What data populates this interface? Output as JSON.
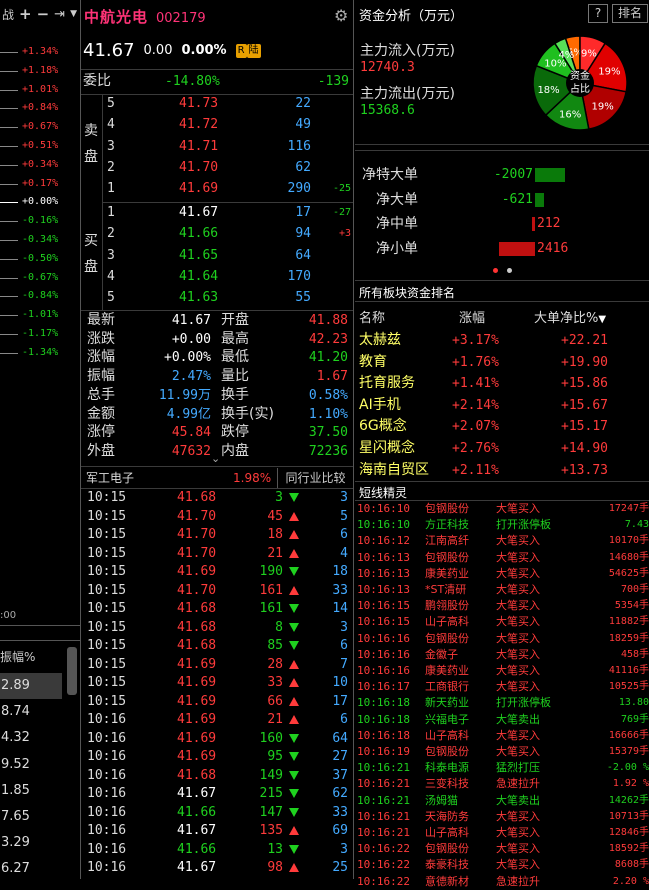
{
  "toolbar": {
    "left_label": "战",
    "icons": [
      "plus-icon",
      "minus-icon",
      "pin-icon",
      "menu-chevron-icon"
    ]
  },
  "chart_axis": {
    "percents": [
      "+1.34%",
      "+1.18%",
      "+1.01%",
      "+0.84%",
      "+0.67%",
      "+0.51%",
      "+0.34%",
      "+0.17%",
      "+0.00%",
      "-0.16%",
      "-0.34%",
      "-0.50%",
      "-0.67%",
      "-0.84%",
      "-1.01%",
      "-1.17%",
      "-1.34%"
    ],
    "time_label": ":00"
  },
  "left_list": {
    "header": "振幅%",
    "values": [
      "2.89",
      "8.74",
      "4.32",
      "9.52",
      "1.85",
      "7.65",
      "3.29",
      "6.27"
    ]
  },
  "stock": {
    "name": "中航光电",
    "code": "002179",
    "price": "41.67",
    "change": "0.00",
    "change_pct": "0.00%",
    "badge_r": "R",
    "badge_lu": "陆"
  },
  "order_ratio": {
    "label": "委比",
    "pct": "-14.80%",
    "diff": "-139"
  },
  "sell": {
    "label": "卖盘",
    "rows": [
      {
        "lvl": "5",
        "price": "41.73",
        "vol": "22",
        "chg": ""
      },
      {
        "lvl": "4",
        "price": "41.72",
        "vol": "49",
        "chg": ""
      },
      {
        "lvl": "3",
        "price": "41.71",
        "vol": "116",
        "chg": ""
      },
      {
        "lvl": "2",
        "price": "41.70",
        "vol": "62",
        "chg": ""
      },
      {
        "lvl": "1",
        "price": "41.69",
        "vol": "290",
        "chg": "-25"
      }
    ]
  },
  "buy": {
    "label": "买盘",
    "rows": [
      {
        "lvl": "1",
        "price": "41.67",
        "vol": "17",
        "chg": "-27"
      },
      {
        "lvl": "2",
        "price": "41.66",
        "vol": "94",
        "chg": "+3"
      },
      {
        "lvl": "3",
        "price": "41.65",
        "vol": "64",
        "chg": ""
      },
      {
        "lvl": "4",
        "price": "41.64",
        "vol": "170",
        "chg": ""
      },
      {
        "lvl": "5",
        "price": "41.63",
        "vol": "55",
        "chg": ""
      }
    ]
  },
  "stats": [
    {
      "l1": "最新",
      "v1": "41.67",
      "c1": "wht",
      "l2": "开盘",
      "v2": "41.88",
      "c2": "red"
    },
    {
      "l1": "涨跌",
      "v1": "+0.00",
      "c1": "wht",
      "l2": "最高",
      "v2": "42.23",
      "c2": "red"
    },
    {
      "l1": "涨幅",
      "v1": "+0.00%",
      "c1": "wht",
      "l2": "最低",
      "v2": "41.20",
      "c2": "grn"
    },
    {
      "l1": "振幅",
      "v1": "2.47%",
      "c1": "cyan",
      "l2": "量比",
      "v2": "1.67",
      "c2": "red"
    },
    {
      "l1": "总手",
      "v1": "11.99万",
      "c1": "cyan",
      "l2": "换手",
      "v2": "0.58%",
      "c2": "cyan"
    },
    {
      "l1": "金额",
      "v1": "4.99亿",
      "c1": "cyan",
      "l2": "换手(实)",
      "v2": "1.10%",
      "c2": "cyan"
    },
    {
      "l1": "涨停",
      "v1": "45.84",
      "c1": "red",
      "l2": "跌停",
      "v2": "37.50",
      "c2": "grn"
    },
    {
      "l1": "外盘",
      "v1": "47632",
      "c1": "red",
      "l2": "内盘",
      "v2": "72236",
      "c2": "grn"
    }
  ],
  "industry": {
    "name": "军工电子",
    "pct": "1.98%",
    "compare": "同行业比较"
  },
  "ticks": [
    {
      "t": "10:15",
      "p": "41.68",
      "pc": "red",
      "v": "3",
      "vc": "grn",
      "d": "dn",
      "n": "3"
    },
    {
      "t": "10:15",
      "p": "41.70",
      "pc": "red",
      "v": "45",
      "vc": "red",
      "d": "up",
      "n": "5"
    },
    {
      "t": "10:15",
      "p": "41.70",
      "pc": "red",
      "v": "18",
      "vc": "red",
      "d": "up",
      "n": "6"
    },
    {
      "t": "10:15",
      "p": "41.70",
      "pc": "red",
      "v": "21",
      "vc": "red",
      "d": "up",
      "n": "4"
    },
    {
      "t": "10:15",
      "p": "41.69",
      "pc": "red",
      "v": "190",
      "vc": "grn",
      "d": "dn",
      "n": "18"
    },
    {
      "t": "10:15",
      "p": "41.70",
      "pc": "red",
      "v": "161",
      "vc": "red",
      "d": "up",
      "n": "33"
    },
    {
      "t": "10:15",
      "p": "41.68",
      "pc": "red",
      "v": "161",
      "vc": "grn",
      "d": "dn",
      "n": "14"
    },
    {
      "t": "10:15",
      "p": "41.68",
      "pc": "red",
      "v": "8",
      "vc": "grn",
      "d": "dn",
      "n": "3"
    },
    {
      "t": "10:15",
      "p": "41.68",
      "pc": "red",
      "v": "85",
      "vc": "grn",
      "d": "dn",
      "n": "6"
    },
    {
      "t": "10:15",
      "p": "41.69",
      "pc": "red",
      "v": "28",
      "vc": "red",
      "d": "up",
      "n": "7"
    },
    {
      "t": "10:15",
      "p": "41.69",
      "pc": "red",
      "v": "33",
      "vc": "red",
      "d": "up",
      "n": "10"
    },
    {
      "t": "10:15",
      "p": "41.69",
      "pc": "red",
      "v": "66",
      "vc": "red",
      "d": "up",
      "n": "17"
    },
    {
      "t": "10:16",
      "p": "41.69",
      "pc": "red",
      "v": "21",
      "vc": "red",
      "d": "up",
      "n": "6"
    },
    {
      "t": "10:16",
      "p": "41.69",
      "pc": "red",
      "v": "160",
      "vc": "grn",
      "d": "dn",
      "n": "64"
    },
    {
      "t": "10:16",
      "p": "41.69",
      "pc": "red",
      "v": "95",
      "vc": "grn",
      "d": "dn",
      "n": "27"
    },
    {
      "t": "10:16",
      "p": "41.68",
      "pc": "red",
      "v": "149",
      "vc": "grn",
      "d": "dn",
      "n": "37"
    },
    {
      "t": "10:16",
      "p": "41.67",
      "pc": "wht",
      "v": "215",
      "vc": "grn",
      "d": "dn",
      "n": "62"
    },
    {
      "t": "10:16",
      "p": "41.66",
      "pc": "grn",
      "v": "147",
      "vc": "grn",
      "d": "dn",
      "n": "33"
    },
    {
      "t": "10:16",
      "p": "41.67",
      "pc": "wht",
      "v": "135",
      "vc": "red",
      "d": "up",
      "n": "69"
    },
    {
      "t": "10:16",
      "p": "41.66",
      "pc": "grn",
      "v": "13",
      "vc": "grn",
      "d": "dn",
      "n": "3"
    },
    {
      "t": "10:16",
      "p": "41.67",
      "pc": "wht",
      "v": "98",
      "vc": "red",
      "d": "up",
      "n": "25"
    }
  ],
  "fund": {
    "title": "资金分析（万元）",
    "help": "?",
    "rank_btn": "排名",
    "in_label": "主力流入(万元)",
    "in_value": "12740.3",
    "out_label": "主力流出(万元)",
    "out_value": "15368.6",
    "pie_center": "资金占比",
    "pie": [
      {
        "pct": "5%",
        "value": 5,
        "color": "#ff6a00"
      },
      {
        "pct": "9%",
        "value": 9,
        "color": "#ff2a2a"
      },
      {
        "pct": "19%",
        "value": 19,
        "color": "#e00000"
      },
      {
        "pct": "19%",
        "value": 19,
        "color": "#b00000"
      },
      {
        "pct": "16%",
        "value": 16,
        "color": "#118811"
      },
      {
        "pct": "18%",
        "value": 18,
        "color": "#0a6a0a"
      },
      {
        "pct": "10%",
        "value": 10,
        "color": "#1fbf1f"
      },
      {
        "pct": "4%",
        "value": 4,
        "color": "#58e058"
      }
    ]
  },
  "netflow": [
    {
      "label": "净特大单",
      "value": "-2007",
      "num": -2007
    },
    {
      "label": "净大单",
      "value": "-621",
      "num": -621
    },
    {
      "label": "净中单",
      "value": "212",
      "num": 212
    },
    {
      "label": "净小单",
      "value": "2416",
      "num": 2416
    }
  ],
  "sector": {
    "title": "所有板块资金排名",
    "col_name": "名称",
    "col_pct": "涨幅",
    "col_ratio": "大单净比%",
    "rows": [
      {
        "name": "太赫兹",
        "pct": "+3.17%",
        "ratio": "+22.21"
      },
      {
        "name": "教育",
        "pct": "+1.76%",
        "ratio": "+19.90"
      },
      {
        "name": "托育服务",
        "pct": "+1.41%",
        "ratio": "+15.86"
      },
      {
        "name": "AI手机",
        "pct": "+2.14%",
        "ratio": "+15.67"
      },
      {
        "name": "6G概念",
        "pct": "+2.07%",
        "ratio": "+15.17"
      },
      {
        "name": "星闪概念",
        "pct": "+2.76%",
        "ratio": "+14.90"
      },
      {
        "name": "海南自贸区",
        "pct": "+2.11%",
        "ratio": "+13.73"
      }
    ]
  },
  "shortline": {
    "title": "短线精灵",
    "rows": [
      {
        "t": "10:16:10",
        "s": "包钢股份",
        "e": "大笔买入",
        "v": "17247手",
        "c": "red"
      },
      {
        "t": "10:16:10",
        "s": "方正科技",
        "e": "打开涨停板",
        "v": "7.43",
        "c": "grn"
      },
      {
        "t": "10:16:12",
        "s": "江南高纤",
        "e": "大笔买入",
        "v": "10170手",
        "c": "red"
      },
      {
        "t": "10:16:13",
        "s": "包钢股份",
        "e": "大笔买入",
        "v": "14680手",
        "c": "red"
      },
      {
        "t": "10:16:13",
        "s": "康美药业",
        "e": "大笔买入",
        "v": "54625手",
        "c": "red"
      },
      {
        "t": "10:16:13",
        "s": "*ST清研",
        "e": "大笔买入",
        "v": "700手",
        "c": "red"
      },
      {
        "t": "10:16:15",
        "s": "鹏翎股份",
        "e": "大笔买入",
        "v": "5354手",
        "c": "red"
      },
      {
        "t": "10:16:15",
        "s": "山子高科",
        "e": "大笔买入",
        "v": "11882手",
        "c": "red"
      },
      {
        "t": "10:16:16",
        "s": "包钢股份",
        "e": "大笔买入",
        "v": "18259手",
        "c": "red"
      },
      {
        "t": "10:16:16",
        "s": "金徽子",
        "e": "大笔买入",
        "v": "458手",
        "c": "red"
      },
      {
        "t": "10:16:16",
        "s": "康美药业",
        "e": "大笔买入",
        "v": "41116手",
        "c": "red"
      },
      {
        "t": "10:16:17",
        "s": "工商银行",
        "e": "大笔买入",
        "v": "10525手",
        "c": "red"
      },
      {
        "t": "10:16:18",
        "s": "新天药业",
        "e": "打开涨停板",
        "v": "13.80",
        "c": "grn"
      },
      {
        "t": "10:16:18",
        "s": "兴福电子",
        "e": "大笔卖出",
        "v": "769手",
        "c": "grn"
      },
      {
        "t": "10:16:18",
        "s": "山子高科",
        "e": "大笔买入",
        "v": "16666手",
        "c": "red"
      },
      {
        "t": "10:16:19",
        "s": "包钢股份",
        "e": "大笔买入",
        "v": "15379手",
        "c": "red"
      },
      {
        "t": "10:16:21",
        "s": "科泰电源",
        "e": "猛烈打压",
        "v": "-2.00 %",
        "c": "grn"
      },
      {
        "t": "10:16:21",
        "s": "三变科技",
        "e": "急速拉升",
        "v": "1.92 %",
        "c": "red"
      },
      {
        "t": "10:16:21",
        "s": "汤姆猫",
        "e": "大笔卖出",
        "v": "14262手",
        "c": "grn"
      },
      {
        "t": "10:16:21",
        "s": "天海防务",
        "e": "大笔买入",
        "v": "10713手",
        "c": "red"
      },
      {
        "t": "10:16:21",
        "s": "山子高科",
        "e": "大笔买入",
        "v": "12846手",
        "c": "red"
      },
      {
        "t": "10:16:22",
        "s": "包钢股份",
        "e": "大笔买入",
        "v": "18592手",
        "c": "red"
      },
      {
        "t": "10:16:22",
        "s": "泰豪科技",
        "e": "大笔买入",
        "v": "8608手",
        "c": "red"
      },
      {
        "t": "10:16:22",
        "s": "意德新材",
        "e": "急速拉升",
        "v": "2.20 %",
        "c": "red"
      }
    ]
  }
}
